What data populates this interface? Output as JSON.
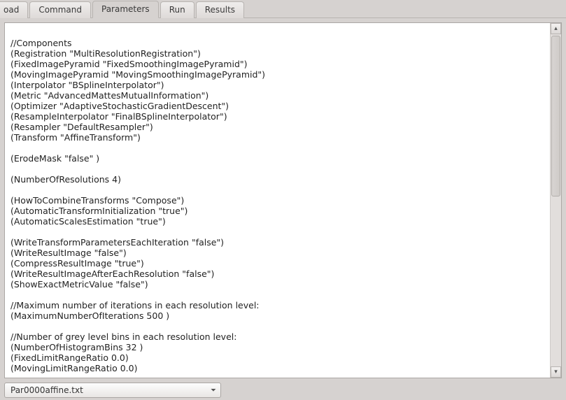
{
  "tabs": {
    "load": "oad",
    "command": "Command",
    "parameters": "Parameters",
    "run": "Run",
    "results": "Results"
  },
  "editor": {
    "content": "\n//Components\n(Registration \"MultiResolutionRegistration\")\n(FixedImagePyramid \"FixedSmoothingImagePyramid\")\n(MovingImagePyramid \"MovingSmoothingImagePyramid\")\n(Interpolator \"BSplineInterpolator\")\n(Metric \"AdvancedMattesMutualInformation\")\n(Optimizer \"AdaptiveStochasticGradientDescent\")\n(ResampleInterpolator \"FinalBSplineInterpolator\")\n(Resampler \"DefaultResampler\")\n(Transform \"AffineTransform\")\n\n(ErodeMask \"false\" )\n\n(NumberOfResolutions 4)\n\n(HowToCombineTransforms \"Compose\")\n(AutomaticTransformInitialization \"true\")\n(AutomaticScalesEstimation \"true\")\n\n(WriteTransformParametersEachIteration \"false\")\n(WriteResultImage \"false\")\n(CompressResultImage \"true\")\n(WriteResultImageAfterEachResolution \"false\")\n(ShowExactMetricValue \"false\")\n\n//Maximum number of iterations in each resolution level:\n(MaximumNumberOfIterations 500 )\n\n//Number of grey level bins in each resolution level:\n(NumberOfHistogramBins 32 )\n(FixedLimitRangeRatio 0.0)\n(MovingLimitRangeRatio 0.0)"
  },
  "bottom": {
    "selected_file": "Par0000affine.txt"
  },
  "icons": {
    "up": "▴",
    "down": "▾",
    "dd": "⏷"
  }
}
